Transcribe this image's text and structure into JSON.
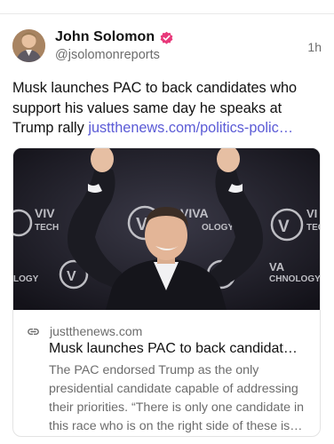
{
  "post": {
    "author_name": "John Solomon",
    "handle": "@jsolomonreports",
    "timestamp": "1h",
    "verified_badge_color": "#e8397a",
    "text": "Musk launches PAC to back candidates who support his values same day he speaks at Trump rally ",
    "link_text": "justthenews.com/politics-polic…",
    "link_color": "#5b5bd6"
  },
  "link_card": {
    "domain": "justthenews.com",
    "title": "Musk launches PAC to back candidat…",
    "description": "The PAC endorsed Trump as the only presidential candidate capable of addressing their priorities. “There is only one candidate in this race who is on the right side of these is…",
    "image": {
      "backdrop_logo_text": "VIVA TECHNOLOGY",
      "backdrop_mark": "V"
    }
  },
  "icons": {
    "verified": "verified-badge-icon",
    "link": "link-icon"
  }
}
